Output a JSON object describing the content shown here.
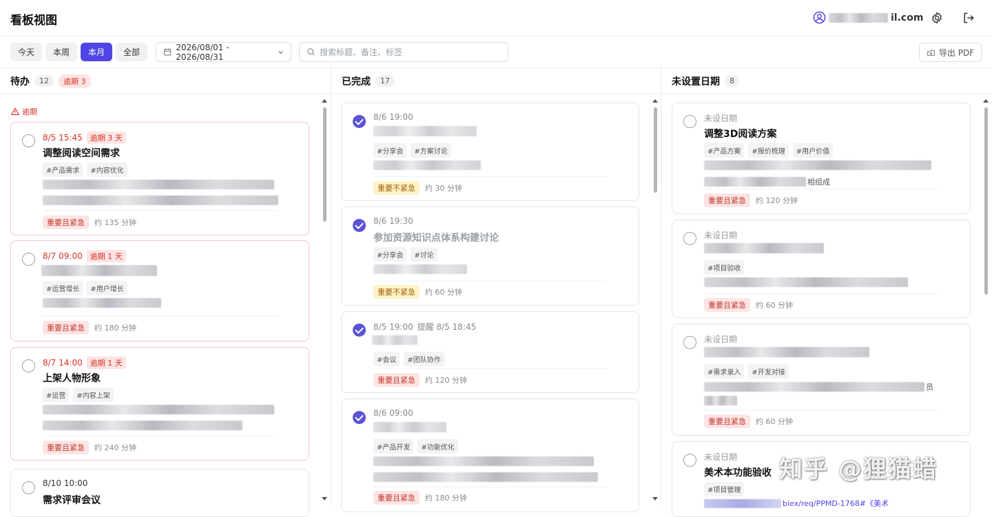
{
  "header": {
    "title": "看板视图",
    "user_email_suffix": "il.com"
  },
  "toolbar": {
    "ranges": [
      "今天",
      "本周",
      "本月",
      "全部"
    ],
    "active_range": "本月",
    "date_range": "2026/08/01 - 2026/08/31",
    "search_placeholder": "搜索标题、备注、标签",
    "export_label": "导出 PDF"
  },
  "columns": {
    "todo": {
      "title": "待办",
      "count": "12",
      "overdue_badge": "逾期 3",
      "section_label": "逾期",
      "cards": [
        {
          "time": "8/5 15:45",
          "overdue": "逾期 3 天",
          "title": "调整阅读空间需求",
          "tags": [
            "#产品需求",
            "#内容优化"
          ],
          "priority": "重要且紧急",
          "duration": "约 135 分钟"
        },
        {
          "time": "8/7 09:00",
          "overdue": "逾期 1 天",
          "title": "",
          "tags": [
            "#运营增长",
            "#用户增长"
          ],
          "priority": "重要且紧急",
          "duration": "约 180 分钟"
        },
        {
          "time": "8/7 14:00",
          "overdue": "逾期 1 天",
          "title": "上架人物形象",
          "tags": [
            "#运营",
            "#内容上架"
          ],
          "priority": "重要且紧急",
          "duration": "约 240 分钟"
        },
        {
          "time": "8/10 10:00",
          "title": "需求评审会议"
        }
      ]
    },
    "done": {
      "title": "已完成",
      "count": "17",
      "cards": [
        {
          "time": "8/6 19:00",
          "title": "",
          "tags": [
            "#分享会",
            "#方案讨论"
          ],
          "priority": "重要不紧急",
          "duration": "约 30 分钟"
        },
        {
          "time": "8/6 19:30",
          "title": "参加资源知识点体系构建讨论",
          "tags": [
            "#分享会",
            "#讨论"
          ],
          "priority": "重要不紧急",
          "duration": "约 60 分钟"
        },
        {
          "time": "8/5 19:00",
          "reminder": "提醒 8/5 18:45",
          "title": "",
          "tags": [
            "#会议",
            "#团队协作"
          ],
          "priority": "重要且紧急",
          "duration": "约 120 分钟"
        },
        {
          "time": "8/6 09:00",
          "title": "",
          "tags": [
            "#产品开发",
            "#功能优化"
          ],
          "priority": "重要且紧急",
          "duration": "约 180 分钟"
        }
      ]
    },
    "nodate": {
      "title": "未设置日期",
      "count": "8",
      "cards": [
        {
          "time": "未设日期",
          "title": "调整3D阅读方案",
          "tags": [
            "#产品方案",
            "#报价梳理",
            "#用户价值"
          ],
          "note_tail": "相组成",
          "priority": "重要且紧急",
          "duration": "约 120 分钟"
        },
        {
          "time": "未设日期",
          "title": "",
          "tags": [
            "#项目验收"
          ],
          "priority": "重要且紧急",
          "duration": "约 60 分钟"
        },
        {
          "time": "未设日期",
          "title": "",
          "tags": [
            "#需求录入",
            "#开发对接"
          ],
          "note_tail": "员",
          "priority": "重要且紧急",
          "duration": "约 60 分钟"
        },
        {
          "time": "未设日期",
          "title": "美术本功能验收",
          "tags": [
            "#项目管理"
          ],
          "note_tail": "biex/req/PPMD-1768#《美术"
        }
      ]
    }
  },
  "watermark": "知乎 @狸猫蜡",
  "colors": {
    "accent": "#4f46e5",
    "overdue": "#d93025",
    "urgent_bg": "#fde4e4",
    "not_urgent_bg": "#fef2c7"
  }
}
